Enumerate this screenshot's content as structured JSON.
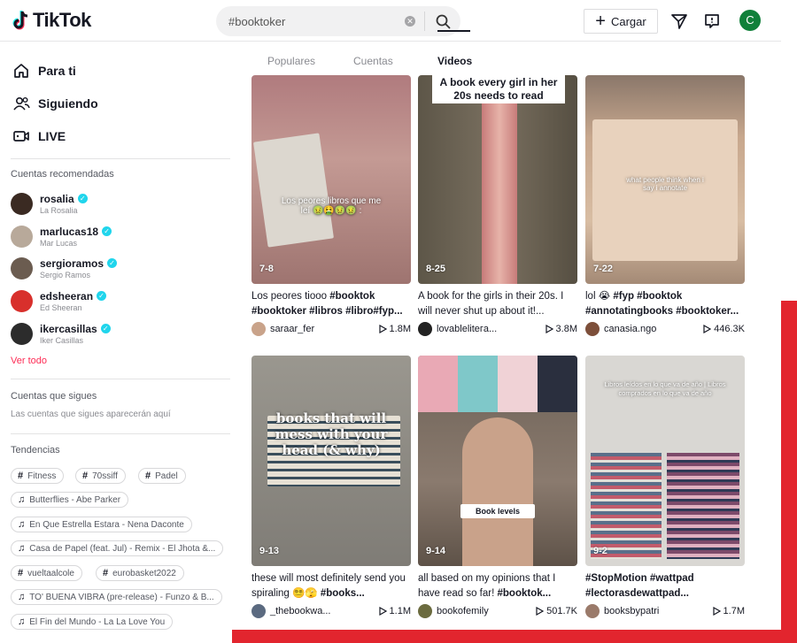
{
  "header": {
    "logo_text": "TikTok",
    "search_value": "#booktoker",
    "upload_label": "Cargar",
    "profile_initial": "C"
  },
  "sidebar": {
    "nav": [
      {
        "label": "Para ti",
        "icon": "home-icon"
      },
      {
        "label": "Siguiendo",
        "icon": "following-icon"
      },
      {
        "label": "LIVE",
        "icon": "live-icon"
      }
    ],
    "recommended_title": "Cuentas recomendadas",
    "accounts": [
      {
        "name": "rosalia",
        "sub": "La Rosalia",
        "color": "#3a2a22"
      },
      {
        "name": "marlucas18",
        "sub": "Mar Lucas",
        "color": "#b8a99a"
      },
      {
        "name": "sergioramos",
        "sub": "Sergio Ramos",
        "color": "#6b5c50"
      },
      {
        "name": "edsheeran",
        "sub": "Ed Sheeran",
        "color": "#d8302c"
      },
      {
        "name": "ikercasillas",
        "sub": "Iker Casillas",
        "color": "#2c2c2c"
      }
    ],
    "see_all": "Ver todo",
    "following_title": "Cuentas que sigues",
    "following_empty": "Las cuentas que sigues aparecerán aquí",
    "trends_title": "Tendencias",
    "trends": [
      {
        "type": "hashtag",
        "label": "Fitness"
      },
      {
        "type": "hashtag",
        "label": "70ssiff"
      },
      {
        "type": "hashtag",
        "label": "Padel"
      },
      {
        "type": "music",
        "label": "Butterflies - Abe Parker"
      },
      {
        "type": "music",
        "label": "En Que Estrella Estara - Nena Daconte"
      },
      {
        "type": "music",
        "label": "Casa de Papel (feat. Jul) - Remix - El Jhota &..."
      },
      {
        "type": "hashtag",
        "label": "vueltaalcole"
      },
      {
        "type": "hashtag",
        "label": "eurobasket2022"
      },
      {
        "type": "music",
        "label": "TO' BUENA VIBRA (pre-release) - Funzo & B..."
      },
      {
        "type": "music",
        "label": "El Fin del Mundo - La La Love You"
      }
    ]
  },
  "tabs": [
    "Populares",
    "Cuentas",
    "Videos"
  ],
  "active_tab": "Videos",
  "videos": [
    {
      "date": "7-8",
      "overlay": "Los peores libros que me leí 🤢🤮🤢🤢 :",
      "caption_plain": "Los peores tiooo ",
      "caption_tags": "#booktok #booktoker #libros #libro#fyp...",
      "user": "saraar_fer",
      "plays": "1.8M",
      "bg": "#b78b86",
      "av": "#c9a38a"
    },
    {
      "date": "8-25",
      "overlay": "A book every girl in her 20s needs to read",
      "caption_plain": "A book for the girls in their 20s. I will never shut up about it!...",
      "caption_tags": "",
      "user": "lovableliteгa...",
      "plays": "3.8M",
      "bg": "#6f6654",
      "av": "#222"
    },
    {
      "date": "7-22",
      "overlay": "what people think when i say i annotate",
      "caption_plain": "lol 😭 ",
      "caption_tags": "#fyp #booktok #annotatingbooks #booktoker...",
      "user": "canasia.ngo",
      "plays": "446.3K",
      "bg": "#b79a83",
      "av": "#7d4f3a"
    },
    {
      "date": "9-13",
      "overlay": "books that will mess with your head (& why)",
      "caption_plain": "these will most definitely send you spiraling 😵‍💫🫣 ",
      "caption_tags": "#books...",
      "user": "_thebookwa...",
      "plays": "1.1M",
      "bg": "#8e8c86",
      "av": "#5b6a80"
    },
    {
      "date": "9-14",
      "overlay": "Book levels",
      "caption_plain": "all based on my opinions that I have read so far! ",
      "caption_tags": "#booktok...",
      "user": "bookofemily",
      "plays": "501.7K",
      "bg": "#6d6257",
      "av": "#6b6b3f"
    },
    {
      "date": "9-2",
      "overlay": "Libros leídos en lo que va de año | Libros comprados en lo que va de año",
      "caption_plain": "",
      "caption_tags": "#StopMotion #wattpad #lectorasdewattpad...",
      "user": "booksbypatri",
      "plays": "1.7M",
      "bg": "#d9d7d3",
      "av": "#9a7a6a"
    }
  ],
  "accent_color": "#fe2c55",
  "frame_color": "#e2252e"
}
